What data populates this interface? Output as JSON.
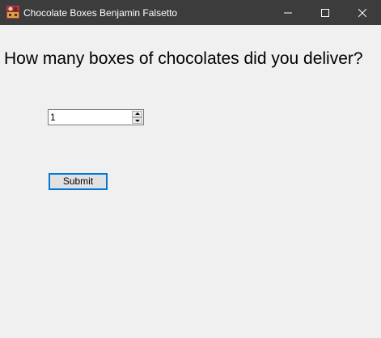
{
  "window": {
    "title": "Chocolate Boxes Benjamin Falsetto",
    "icon": "chocolate-box-icon",
    "controls": {
      "minimize_icon": "minimize-icon",
      "maximize_icon": "maximize-icon",
      "close_icon": "close-icon"
    }
  },
  "form": {
    "question": "How many boxes of chocolates did you deliver?",
    "quantity_value": "1",
    "submit_label": "Submit"
  },
  "colors": {
    "titlebar_bg": "#3c3c3c",
    "window_bg": "#f0f0f0",
    "focus_accent": "#0078d7"
  }
}
